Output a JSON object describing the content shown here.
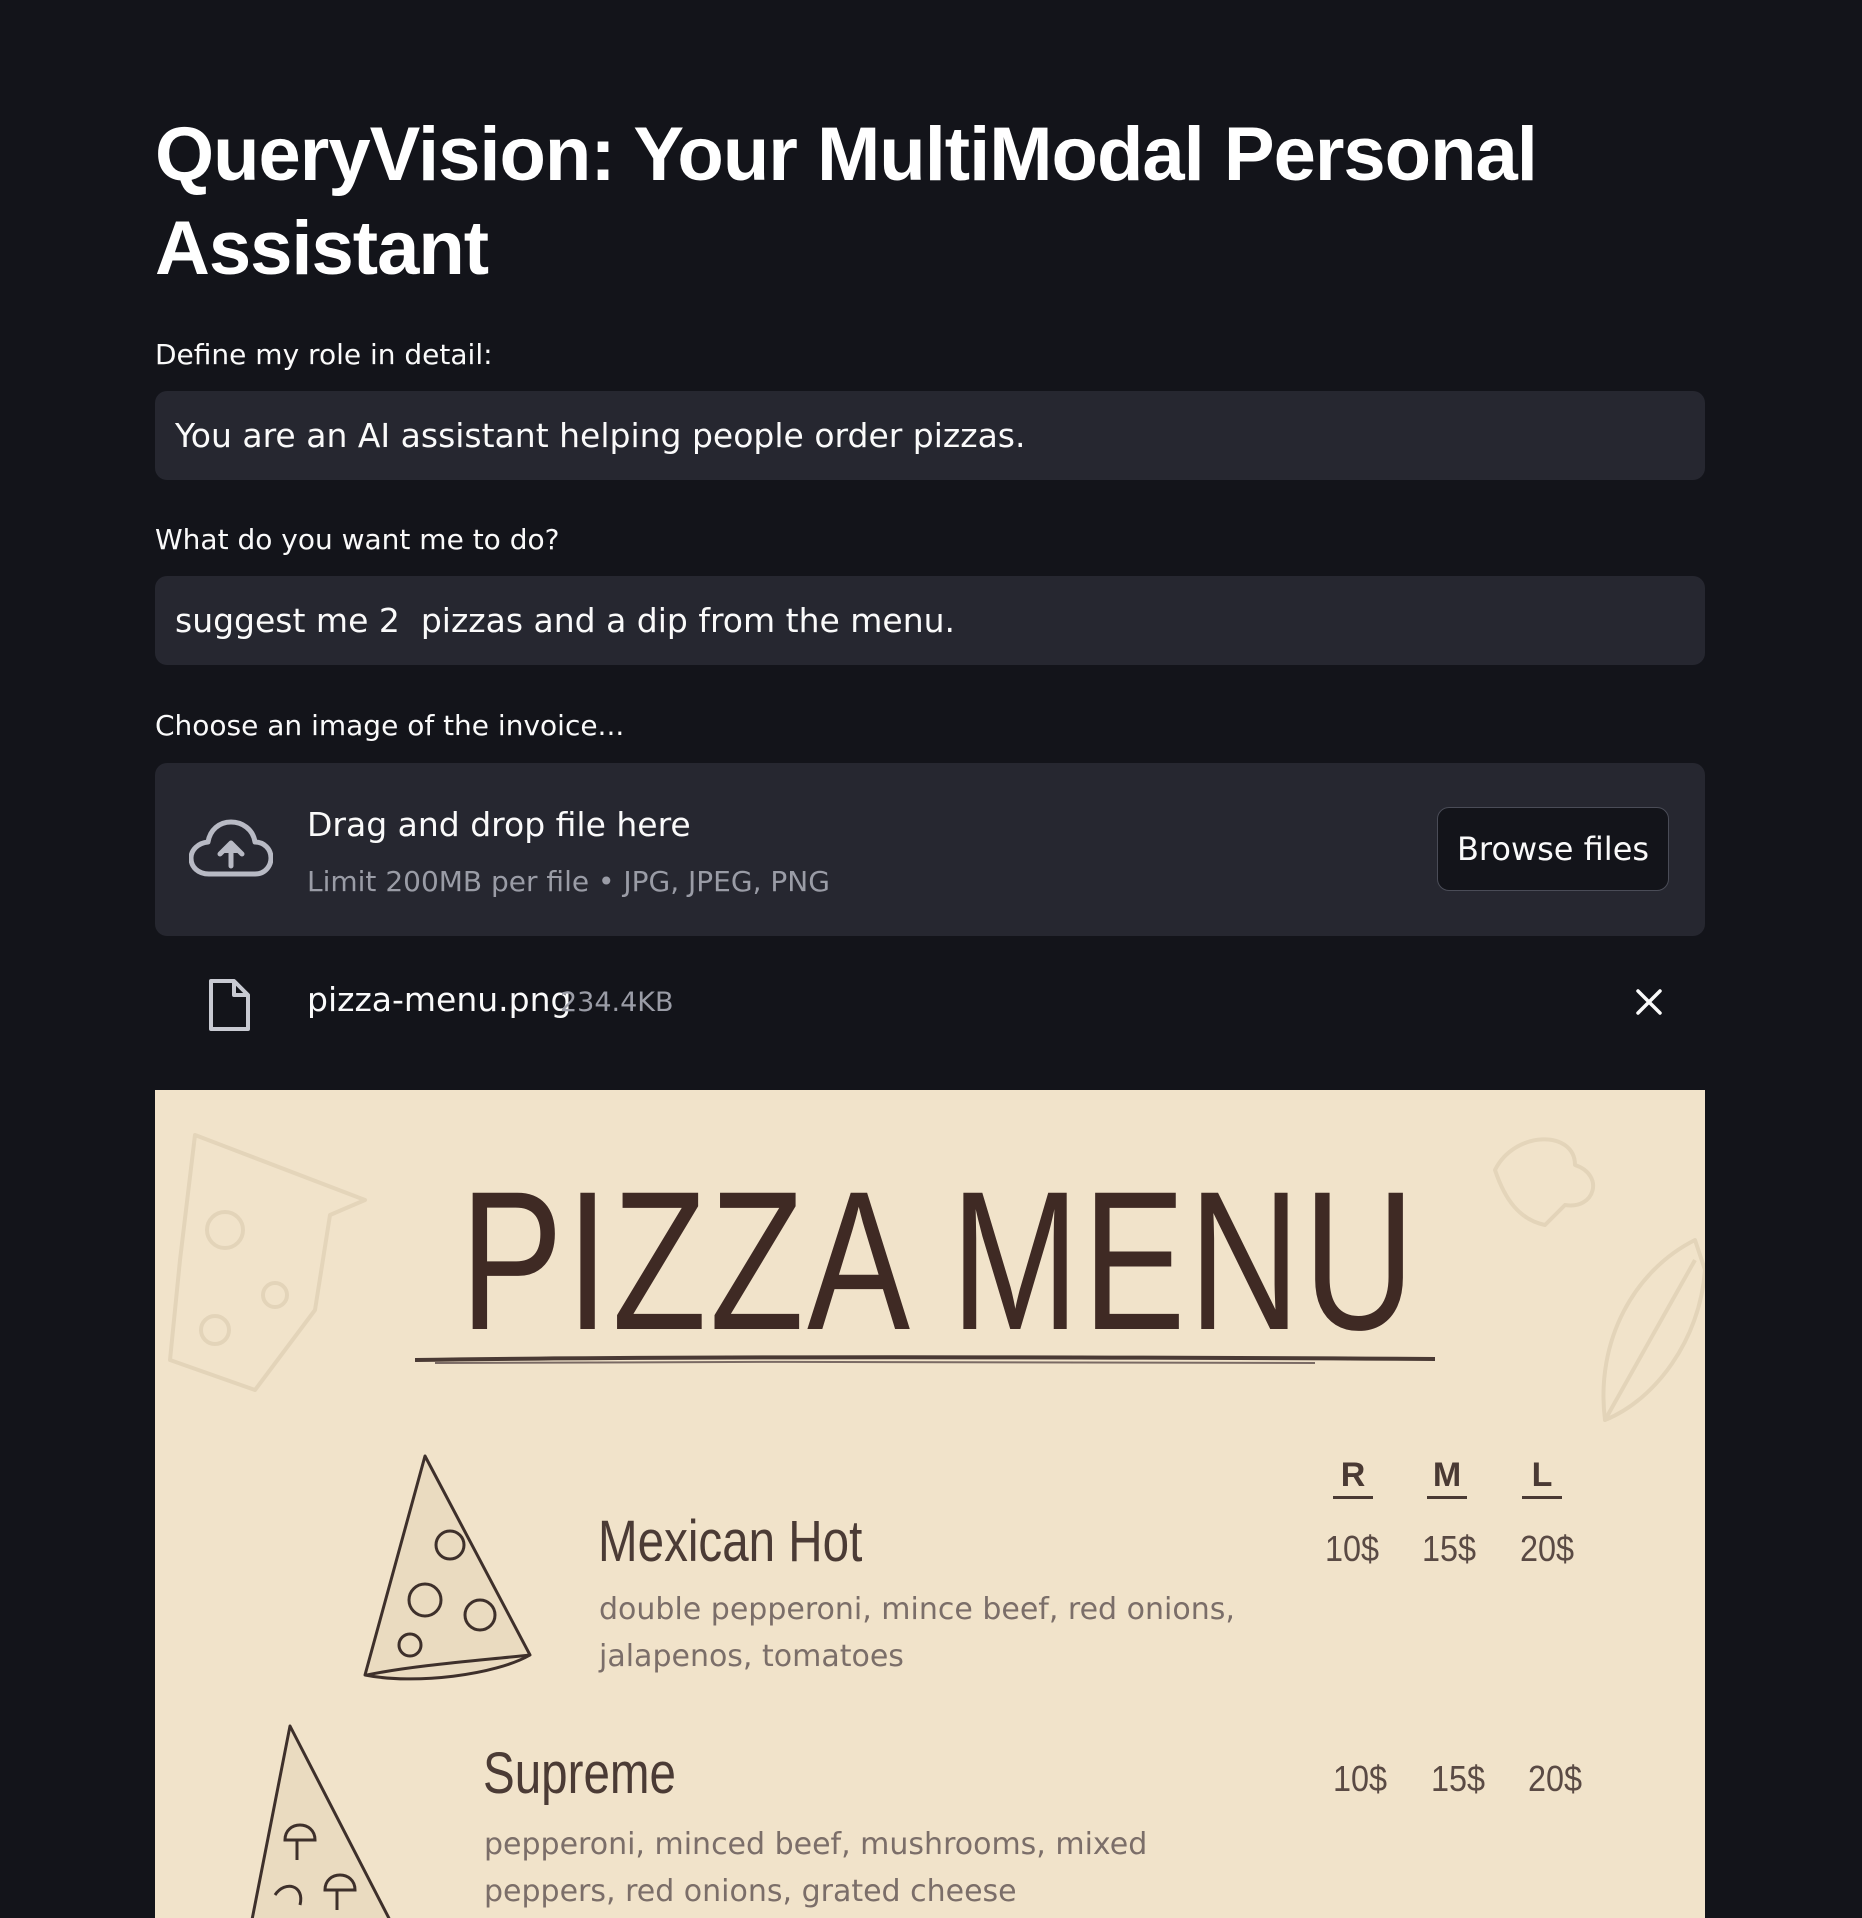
{
  "app": {
    "title": "QueryVision: Your MultiModal Personal Assistant"
  },
  "role_field": {
    "label": "Define my role in detail:",
    "value": "You are an AI assistant helping people order pizzas."
  },
  "task_field": {
    "label": "What do you want me to do?",
    "value": "suggest me 2  pizzas and a dip from the menu."
  },
  "uploader": {
    "label": "Choose an image of the invoice...",
    "drop_text": "Drag and drop file here",
    "limit_text": "Limit 200MB per file • JPG, JPEG, PNG",
    "browse_label": "Browse files",
    "icon": "cloud-upload-icon"
  },
  "uploaded_file": {
    "name": "pizza-menu.png",
    "size": "234.4KB",
    "icon": "file-icon",
    "remove_icon": "close-icon"
  },
  "menu_image": {
    "heading": "PIZZA MENU",
    "sizes": [
      "R",
      "M",
      "L"
    ],
    "items": [
      {
        "name": "Mexican Hot",
        "description": "double pepperoni, mince beef, red onions, jalapenos, tomatoes",
        "prices": [
          "10$",
          "15$",
          "20$"
        ]
      },
      {
        "name": "Supreme",
        "description": "pepperoni, minced beef, mushrooms, mixed peppers, red onions, grated cheese",
        "prices": [
          "10$",
          "15$",
          "20$"
        ]
      }
    ],
    "colors": {
      "background": "#f1e3ca",
      "heading": "#3f2a24",
      "text": "#7b6e69"
    }
  },
  "theme": {
    "page_bg": "#13141a",
    "field_bg": "#262730",
    "text": "#fafafa",
    "muted": "#9a9ca6"
  }
}
